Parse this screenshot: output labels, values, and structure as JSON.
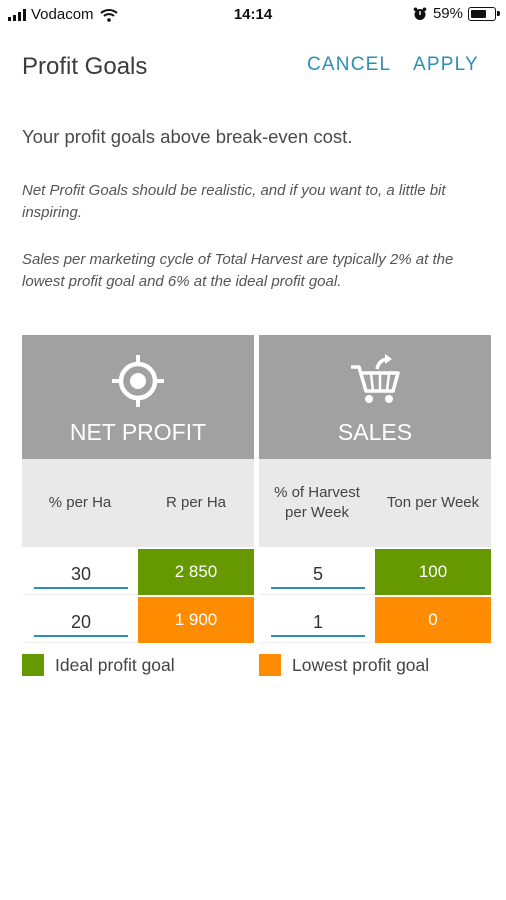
{
  "status_bar": {
    "carrier": "Vodacom",
    "time": "14:14",
    "battery": "59%"
  },
  "header": {
    "title": "Profit Goals",
    "cancel_label": "CANCEL",
    "apply_label": "APPLY"
  },
  "intro": "Your profit goals above break-even cost.",
  "notes": [
    "Net Profit Goals should be realistic, and if you want to, a little bit inspiring.",
    "Sales per marketing cycle of Total Harvest are typically 2% at the lowest profit goal and 6% at the ideal profit goal."
  ],
  "net_profit": {
    "title": "NET PROFIT",
    "icon": "target-icon",
    "col1": "% per Ha",
    "col2": "R per Ha",
    "ideal_percent": "30",
    "ideal_value": "2 850",
    "lowest_percent": "20",
    "lowest_value": "1 900"
  },
  "sales": {
    "title": "SALES",
    "icon": "cart-icon",
    "col1": "% of Harvest per Week",
    "col2": "Ton per Week",
    "ideal_percent": "5",
    "ideal_value": "100",
    "lowest_percent": "1",
    "lowest_value": "0"
  },
  "legend": {
    "ideal": "Ideal profit goal",
    "lowest": "Lowest profit goal"
  },
  "colors": {
    "accent": "#2b8fb3",
    "ideal": "#669900",
    "lowest": "#ff8c00",
    "card_header": "#a1a1a1"
  }
}
